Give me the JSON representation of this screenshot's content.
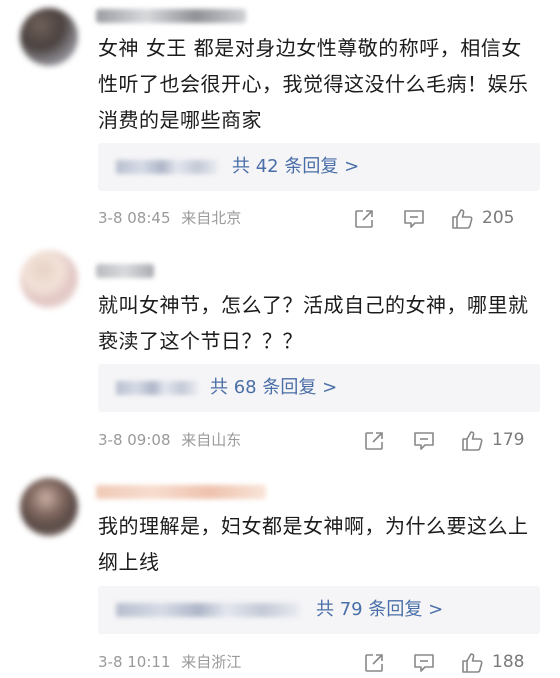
{
  "comments": [
    {
      "text": "女神  女王 都是对身边女性尊敬的称呼，相信女性听了也会很开心，我觉得这没什么毛病！娱乐消费的是哪些商家",
      "reply_label": "共 42 条回复 >",
      "date": "3-8 08:45",
      "location": "来自北京",
      "likes": "205"
    },
    {
      "text": "就叫女神节，怎么了？活成自己的女神，哪里就亵渎了这个节日？？？",
      "reply_label": "共 68 条回复 >",
      "date": "3-8 09:08",
      "location": "来自山东",
      "likes": "179"
    },
    {
      "text": "我的理解是，妇女都是女神啊，为什么要这么上纲上线",
      "reply_label": "共 79 条回复 >",
      "date": "3-8 10:11",
      "location": "来自浙江",
      "likes": "188"
    }
  ],
  "colors": {
    "link": "#4a6fa8",
    "meta": "#9a9a9a",
    "reply_bg": "#f5f5f7"
  },
  "icons": [
    "share-icon",
    "comment-icon",
    "like-icon"
  ]
}
